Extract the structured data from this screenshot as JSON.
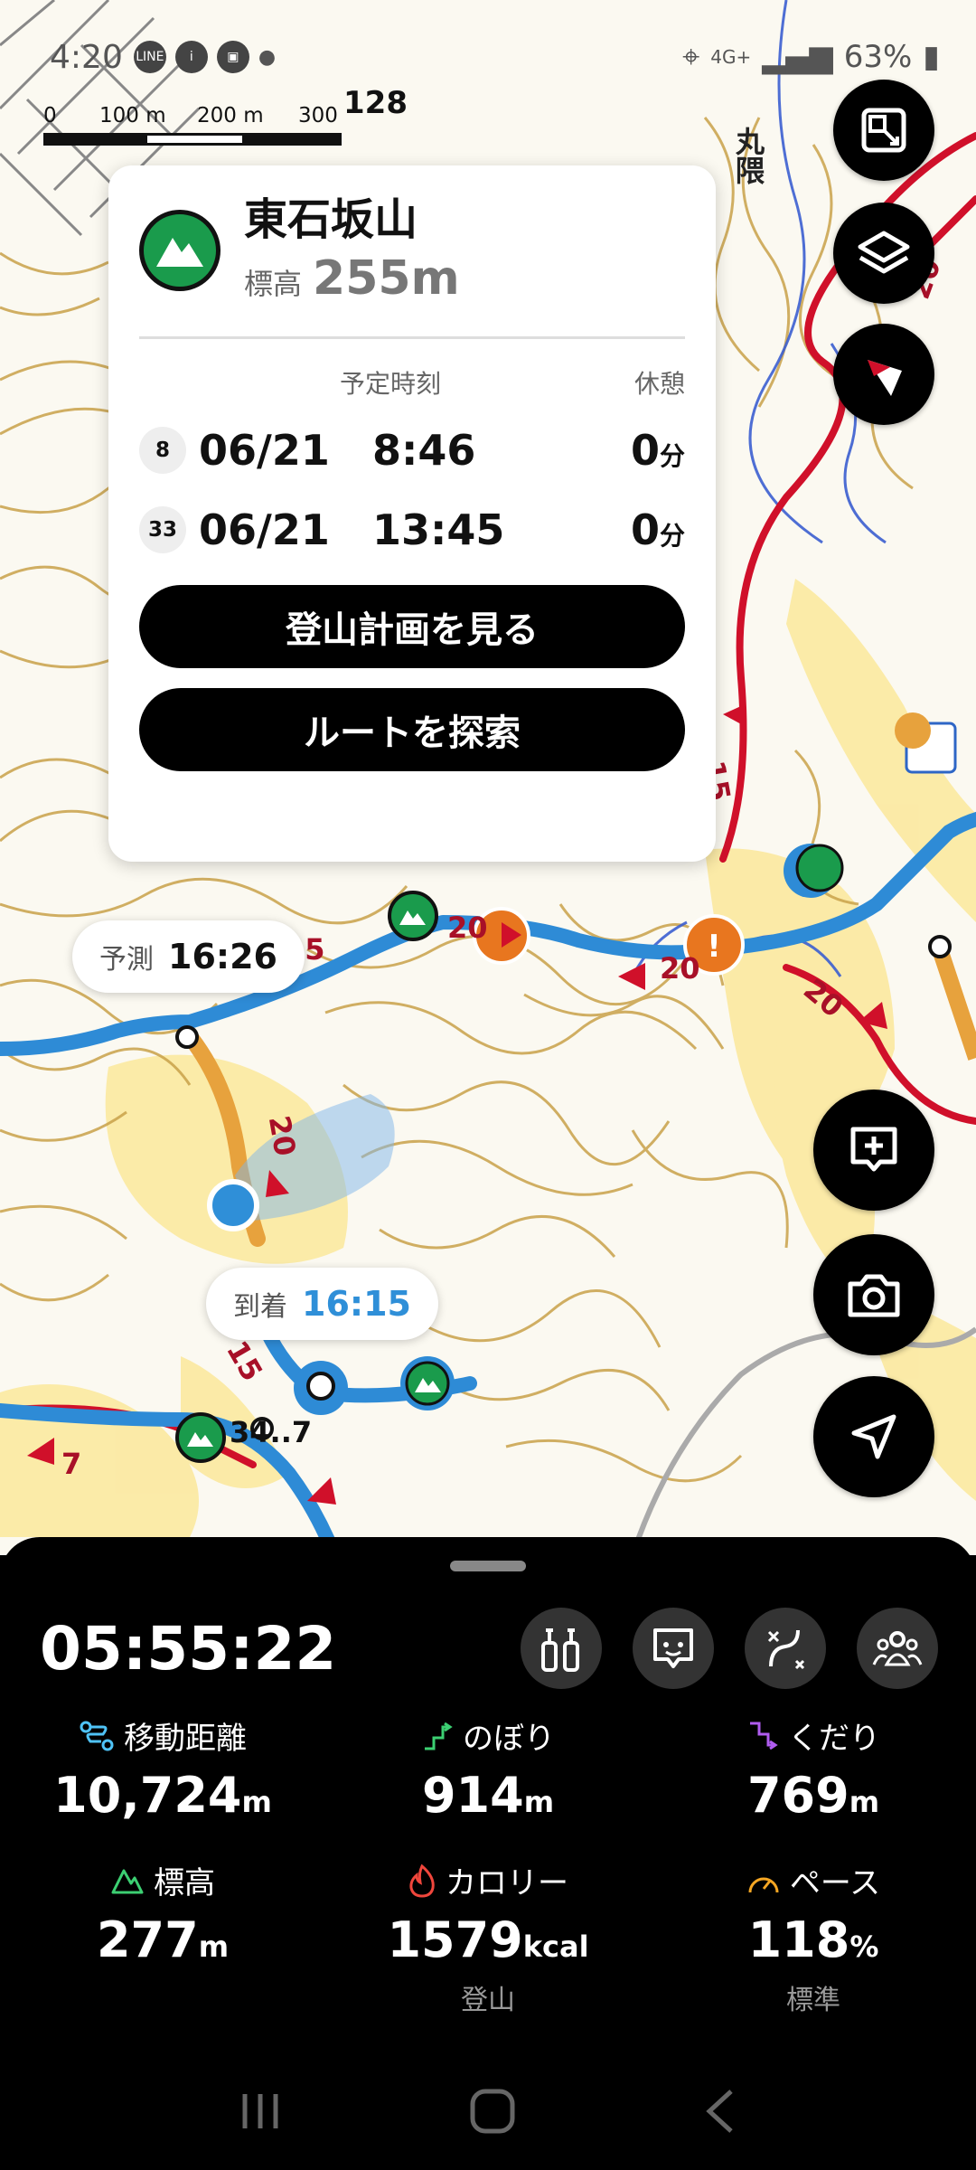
{
  "status": {
    "time": "4:20",
    "network": "4G+",
    "battery": "63%"
  },
  "scale": {
    "labels": [
      "0",
      "100 m",
      "200 m",
      "300 m"
    ]
  },
  "map_labels": {
    "spot_height": "128",
    "place": "丸隈",
    "junction": "34..7",
    "segment_times": [
      "20",
      "15",
      "20",
      "20",
      "15",
      "20",
      "15",
      "20",
      "7"
    ]
  },
  "card": {
    "name": "東石坂山",
    "elevation_label": "標高",
    "elevation_value": "255m",
    "col_time": "予定時刻",
    "col_rest": "休憩",
    "rows": [
      {
        "no": "8",
        "date": "06/21",
        "time": "8:46",
        "rest": "0",
        "unit": "分"
      },
      {
        "no": "33",
        "date": "06/21",
        "time": "13:45",
        "rest": "0",
        "unit": "分"
      }
    ],
    "btn_plan": "登山計画を見る",
    "btn_route": "ルートを探索"
  },
  "pills": {
    "forecast_label": "予測",
    "forecast_value": "16:26",
    "arrival_label": "到着",
    "arrival_value": "16:15"
  },
  "panel": {
    "timer": "05:55:22",
    "stats": [
      {
        "key": "distance",
        "label": "移動距離",
        "value": "10,724",
        "unit": "m",
        "sub": ""
      },
      {
        "key": "ascent",
        "label": "のぼり",
        "value": "914",
        "unit": "m",
        "sub": ""
      },
      {
        "key": "descent",
        "label": "くだり",
        "value": "769",
        "unit": "m",
        "sub": ""
      },
      {
        "key": "altitude",
        "label": "標高",
        "value": "277",
        "unit": "m",
        "sub": ""
      },
      {
        "key": "calorie",
        "label": "カロリー",
        "value": "1579",
        "unit": "kcal",
        "sub": "登山"
      },
      {
        "key": "pace",
        "label": "ペース",
        "value": "118",
        "unit": "%",
        "sub": "標準"
      }
    ]
  },
  "colors": {
    "route_blue": "#2e8bd6",
    "road_red": "#d0102a",
    "contour": "#c9a24a",
    "peak_green": "#1a9b4c",
    "warning_orange": "#e8761f",
    "arrival_blue": "#2f8fd8"
  }
}
